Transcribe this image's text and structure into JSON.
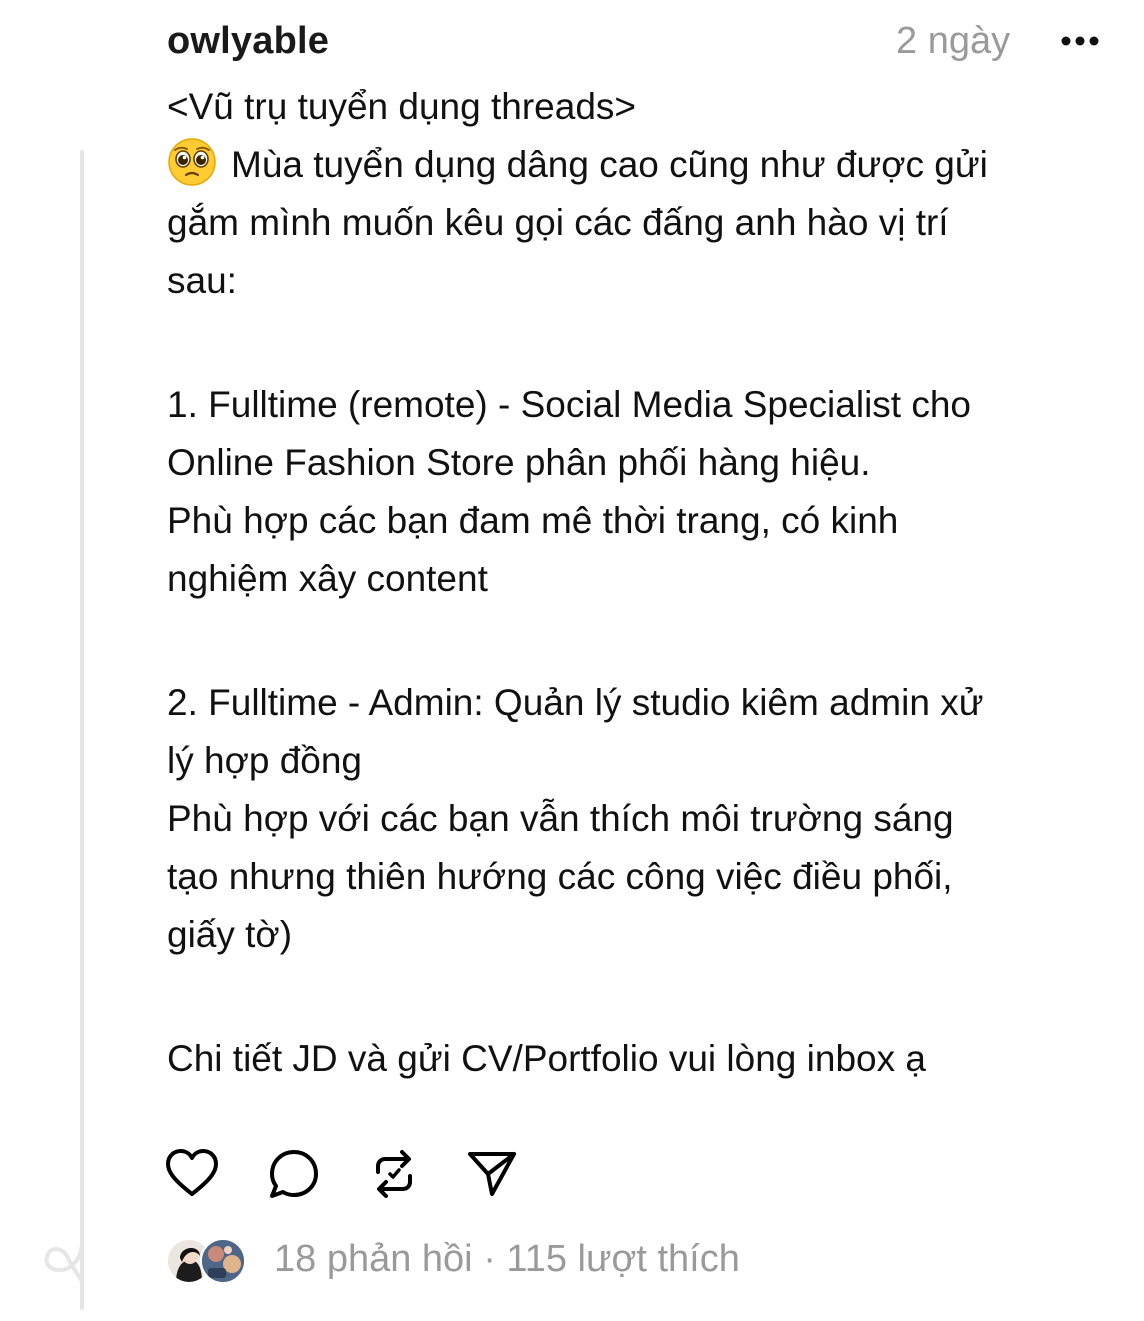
{
  "post": {
    "username": "owlyable",
    "time": "2 ngày",
    "more_icon": "more-horizontal-icon",
    "lines": [
      "<Vũ trụ tuyển dụng threads>",
      "Mùa tuyển dụng dâng cao cũng như được gửi",
      "gắm mình muốn kêu gọi các đấng anh hào vị trí",
      "sau:",
      "1. Fulltime (remote) - Social Media Specialist cho",
      "Online Fashion Store phân phối hàng hiệu.",
      "Phù hợp các bạn đam mê thời trang, có kinh",
      "nghiệm xây content",
      "2. Fulltime - Admin: Quản lý studio kiêm admin xử",
      "lý hợp đồng",
      "Phù hợp với các bạn vẫn thích môi trường sáng",
      "tạo nhưng thiên hướng các công việc điều phối,",
      "giấy tờ)",
      "Chi tiết JD và gửi CV/Portfolio vui lòng inbox ạ"
    ],
    "emoji": "pleading-face-icon"
  },
  "actions": {
    "like_icon": "heart-icon",
    "reply_icon": "comment-icon",
    "repost_icon": "repost-icon",
    "share_icon": "send-icon"
  },
  "stats": {
    "replies": "18 phản hồi",
    "separator": " · ",
    "likes": "115 lượt thích"
  },
  "colors": {
    "text": "#111111",
    "muted": "#9a9a9a",
    "thread_line": "#e6e6e6"
  }
}
